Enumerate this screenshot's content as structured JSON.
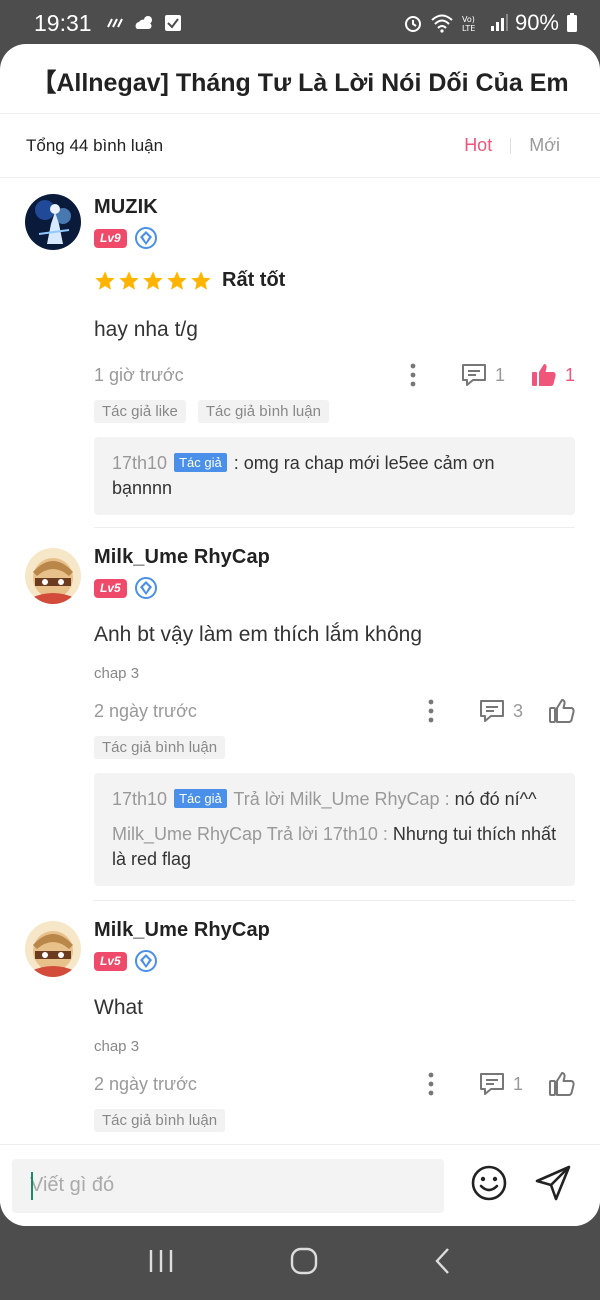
{
  "status_bar": {
    "time": "19:31",
    "battery_pct": "90%",
    "network": "LTE"
  },
  "title": "【Allnegav] Tháng Tư Là Lời Nói Dối Của Em",
  "sub_header": {
    "total_label": "Tổng 44 bình luận",
    "tab_hot": "Hot",
    "tab_new": "Mới"
  },
  "comments": [
    {
      "username": "MUZIK",
      "level": "Lv9",
      "rating_label": "Rất tốt",
      "stars": 5,
      "text": "hay nha t/g",
      "time": "1 giờ trước",
      "reply_count": "1",
      "like_count": "1",
      "tags": [
        "Tác giả like",
        "Tác giả bình luận"
      ],
      "replies": [
        {
          "name": "17th10",
          "author_tag": "Tác giả",
          "sep": " : ",
          "text": "omg ra chap mới le5ee cảm ơn bạnnnn"
        }
      ]
    },
    {
      "username": "Milk_Ume RhyCap",
      "level": "Lv5",
      "text": "Anh bt vậy làm em thích lắm không",
      "chap": "chap 3",
      "time": "2 ngày trước",
      "reply_count": "3",
      "tags": [
        "Tác giả bình luận"
      ],
      "replies": [
        {
          "name": "17th10",
          "author_tag": "Tác giả",
          "reply_to": " Trả lời Milk_Ume RhyCap : ",
          "text": "nó đó ní^^"
        },
        {
          "name": "Milk_Ume RhyCap",
          "reply_to": " Trả lời 17th10 : ",
          "text": "Nhưng tui thích nhất là red flag"
        }
      ]
    },
    {
      "username": "Milk_Ume RhyCap",
      "level": "Lv5",
      "text": "What",
      "chap": "chap 3",
      "time": "2 ngày trước",
      "reply_count": "1",
      "tags": [
        "Tác giả bình luận"
      ]
    }
  ],
  "input": {
    "placeholder": "Viết gì đó"
  },
  "colors": {
    "accent_pink": "#f0557a",
    "author_blue": "#4a8fe8",
    "star_yellow": "#ffb400"
  }
}
